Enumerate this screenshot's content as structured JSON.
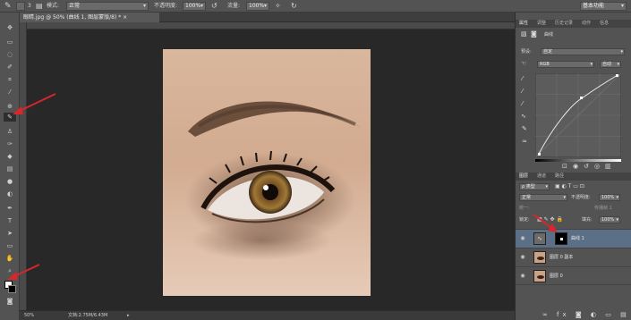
{
  "options_bar": {
    "mode_label": "模式:",
    "mode_value": "正常",
    "opacity_label": "不透明度:",
    "opacity_value": "100%",
    "flow_label": "流量:",
    "flow_value": "100%",
    "brush_size": "3",
    "workspace_value": "基本功能"
  },
  "document": {
    "tab_title": "眼睛.jpg @ 50% (曲线 1, 图层蒙版/8) * ×",
    "zoom": "50%",
    "doc_info": "文档:2.75M/6.43M"
  },
  "properties_panel": {
    "tabs": [
      "属性",
      "调整",
      "历史记录",
      "动作",
      "信息"
    ],
    "title": "曲线",
    "preset_label": "预设:",
    "preset_value": "自定",
    "channel_value": "RGB",
    "auto_button": "自动"
  },
  "layers_panel": {
    "tabs": [
      "图层",
      "通道",
      "路径"
    ],
    "kind_value": "ρ 类型",
    "blend_value": "正常",
    "opacity_label": "不透明度:",
    "opacity_value": "100%",
    "lock_label": "锁定:",
    "fill_label": "填充:",
    "fill_value": "100%",
    "unify_label": "统一:",
    "propagate_label": "传播帧 1",
    "layers": [
      {
        "name": "曲线 1",
        "selected": true
      },
      {
        "name": "图层 0 副本",
        "selected": false
      },
      {
        "name": "图层 0",
        "selected": false
      }
    ]
  },
  "colors": {
    "accent_arrow": "#d8262b",
    "selected_layer": "#5b6f86"
  },
  "icons": [
    "brush-icon",
    "move-icon",
    "marquee-icon",
    "lasso-icon",
    "quick-select-icon",
    "crop-icon",
    "eyedropper-icon",
    "healing-icon",
    "brush-tool-icon",
    "stamp-icon",
    "history-brush-icon",
    "eraser-icon",
    "gradient-icon",
    "blur-icon",
    "dodge-icon",
    "pen-icon",
    "type-icon",
    "path-select-icon",
    "shape-icon",
    "hand-icon",
    "zoom-icon",
    "eye-icon",
    "curves-icon"
  ]
}
